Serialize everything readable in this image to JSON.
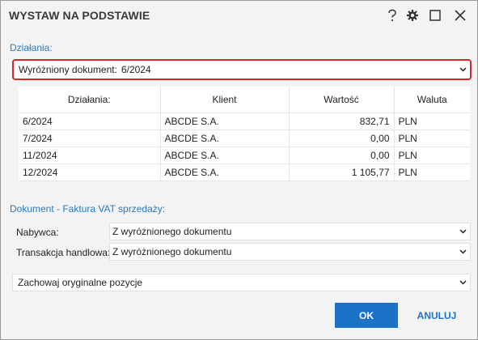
{
  "window": {
    "title": "WYSTAW NA PODSTAWIE",
    "help_icon": "help-icon",
    "settings_icon": "gear-icon",
    "maximize_icon": "maximize-icon",
    "close_icon": "close-icon"
  },
  "actions": {
    "section_label": "Działania:",
    "highlighted_label": "Wyróżniony dokument:",
    "highlighted_value": "6/2024",
    "table": {
      "headers": [
        "Działania:",
        "Klient",
        "Wartość",
        "Waluta"
      ],
      "rows": [
        [
          "6/2024",
          "ABCDE S.A.",
          "832,71",
          "PLN"
        ],
        [
          "7/2024",
          "ABCDE S.A.",
          "0,00",
          "PLN"
        ],
        [
          "11/2024",
          "ABCDE S.A.",
          "0,00",
          "PLN"
        ],
        [
          "12/2024",
          "ABCDE S.A.",
          "1 105,77",
          "PLN"
        ]
      ]
    }
  },
  "document": {
    "section_label": "Dokument - Faktura VAT sprzedaży:",
    "buyer_label": "Nabywca:",
    "buyer_value": "Z wyróżnionego dokumentu",
    "transaction_label": "Transakcja handlowa:",
    "transaction_value": "Z wyróżnionego dokumentu",
    "positions_value": "Zachowaj oryginalne pozycje"
  },
  "buttons": {
    "ok": "OK",
    "cancel": "ANULUJ"
  },
  "colors": {
    "accent": "#1a73c7",
    "section": "#2a7ab8",
    "highlight_border": "#d9252a"
  }
}
